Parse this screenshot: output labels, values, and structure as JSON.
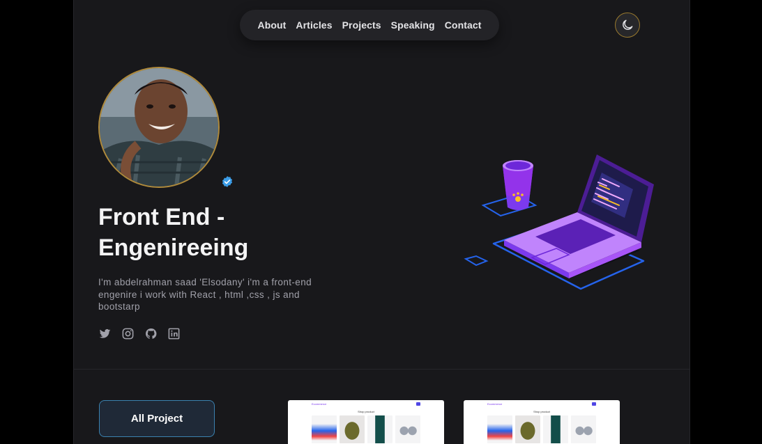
{
  "nav": {
    "items": [
      "About",
      "Articles",
      "Projects",
      "Speaking",
      "Contact"
    ]
  },
  "theme_toggle": {
    "icon": "moon-icon"
  },
  "profile": {
    "headline": "Front End - Engenireeing",
    "bio": "I'm abdelrahman saad 'Elsodany' i'm a front-end engenire i work with React , html ,css , js and bootstarp",
    "verified_icon": "verified-badge-icon"
  },
  "socials": [
    "twitter-icon",
    "instagram-icon",
    "github-icon",
    "linkedin-icon"
  ],
  "projects": {
    "button_label": "All Project",
    "cards": [
      {
        "logo": "Ecommerce",
        "title": "Shop product"
      },
      {
        "logo": "Ecommerce",
        "title": "Shop product"
      }
    ]
  },
  "colors": {
    "page_bg": "#18181b",
    "outer_bg": "#000000",
    "accent_border": "#3b82b0",
    "avatar_ring": "#b08a3a",
    "verified": "#3b9de8",
    "laptop_purple": "#7c3aed"
  }
}
